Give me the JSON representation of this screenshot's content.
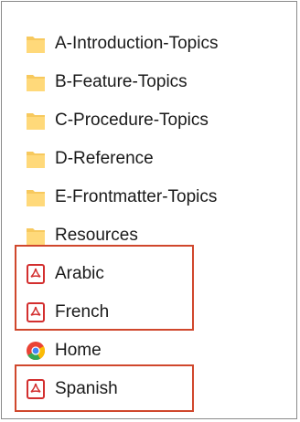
{
  "items": [
    {
      "label": "A-Introduction-Topics",
      "icon": "folder-icon"
    },
    {
      "label": "B-Feature-Topics",
      "icon": "folder-icon"
    },
    {
      "label": "C-Procedure-Topics",
      "icon": "folder-icon"
    },
    {
      "label": "D-Reference",
      "icon": "folder-icon"
    },
    {
      "label": "E-Frontmatter-Topics",
      "icon": "folder-icon"
    },
    {
      "label": "Resources",
      "icon": "folder-icon"
    },
    {
      "label": "Arabic",
      "icon": "pdf-icon"
    },
    {
      "label": "French",
      "icon": "pdf-icon"
    },
    {
      "label": "Home",
      "icon": "chrome-icon"
    },
    {
      "label": "Spanish",
      "icon": "pdf-icon"
    }
  ],
  "colors": {
    "folder": "#f7c95e",
    "pdf_red": "#d32f2f",
    "highlight_border": "#d0472c"
  }
}
